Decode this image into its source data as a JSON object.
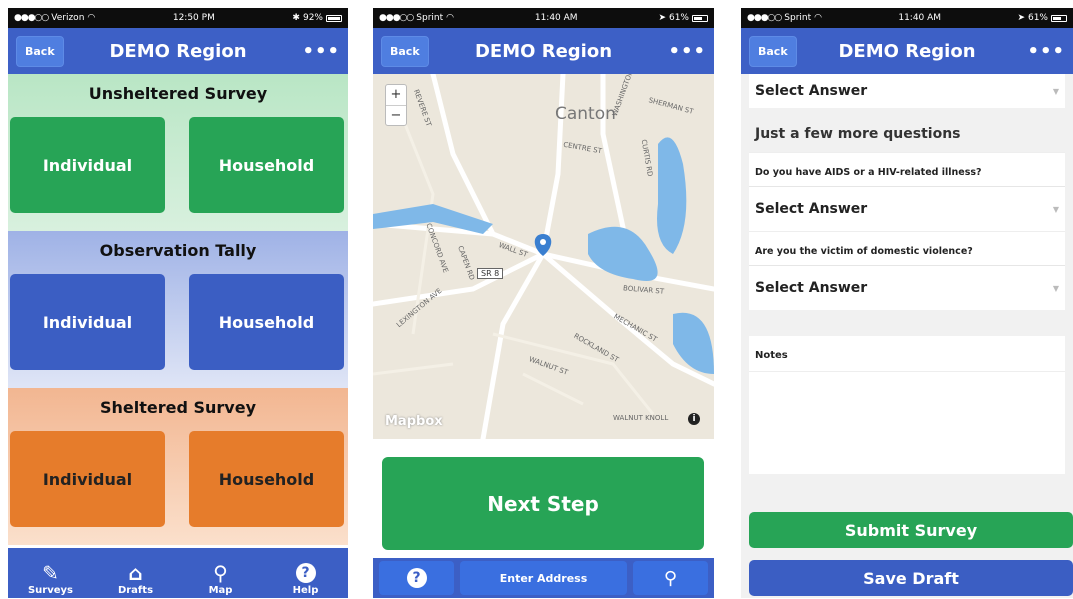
{
  "colors": {
    "nav_blue": "#3d60c6",
    "green": "#27a456",
    "blue": "#3b5ec3",
    "orange": "#e67c2b"
  },
  "screen1": {
    "status": {
      "carrier": "Verizon",
      "time": "12:50 PM",
      "battery": "92%",
      "battery_level": 0.92
    },
    "nav": {
      "back": "Back",
      "title": "DEMO Region",
      "more": "•••"
    },
    "sections": [
      {
        "title": "Unsheltered Survey",
        "left": "Individual",
        "right": "Household"
      },
      {
        "title": "Observation Tally",
        "left": "Individual",
        "right": "Household"
      },
      {
        "title": "Sheltered Survey",
        "left": "Individual",
        "right": "Household"
      }
    ],
    "tabs": [
      {
        "label": "Surveys",
        "icon": "edit-icon"
      },
      {
        "label": "Drafts",
        "icon": "inbox-icon"
      },
      {
        "label": "Map",
        "icon": "map-pin-icon"
      },
      {
        "label": "Help",
        "icon": "help-icon"
      }
    ]
  },
  "screen2": {
    "status": {
      "carrier": "Sprint",
      "time": "11:40 AM",
      "battery": "61%",
      "battery_level": 0.61
    },
    "nav": {
      "back": "Back",
      "title": "DEMO Region",
      "more": "•••"
    },
    "map": {
      "city": "Canton",
      "zoom_in": "+",
      "zoom_out": "−",
      "logo": "Mapbox",
      "badge": "SR 8",
      "streets": [
        "WASHINGTON ST",
        "SHERMAN ST",
        "CENTRE ST",
        "CURTIS RD",
        "REVERE ST",
        "WALL ST",
        "BOLIVAR ST",
        "MECHANIC ST",
        "ROCKLAND ST",
        "WALNUT ST",
        "WALNUT KNOLL",
        "LEXINGTON AVE",
        "CONCORD AVE",
        "CAPEN RD"
      ]
    },
    "next_step": "Next Step",
    "bottom": {
      "help": "?",
      "address": "Enter Address",
      "pin": "pin"
    }
  },
  "screen3": {
    "status": {
      "carrier": "Sprint",
      "time": "11:40 AM",
      "battery": "61%",
      "battery_level": 0.61
    },
    "nav": {
      "back": "Back",
      "title": "DEMO Region",
      "more": "•••"
    },
    "top_select": "Select Answer",
    "group_title": "Just a few more questions",
    "questions": [
      {
        "label": "Do you have AIDS or a HIV-related illness?",
        "answer": "Select Answer"
      },
      {
        "label": "Are you the victim of domestic violence?",
        "answer": "Select Answer"
      }
    ],
    "notes_label": "Notes",
    "submit": "Submit Survey",
    "save_draft": "Save Draft"
  }
}
